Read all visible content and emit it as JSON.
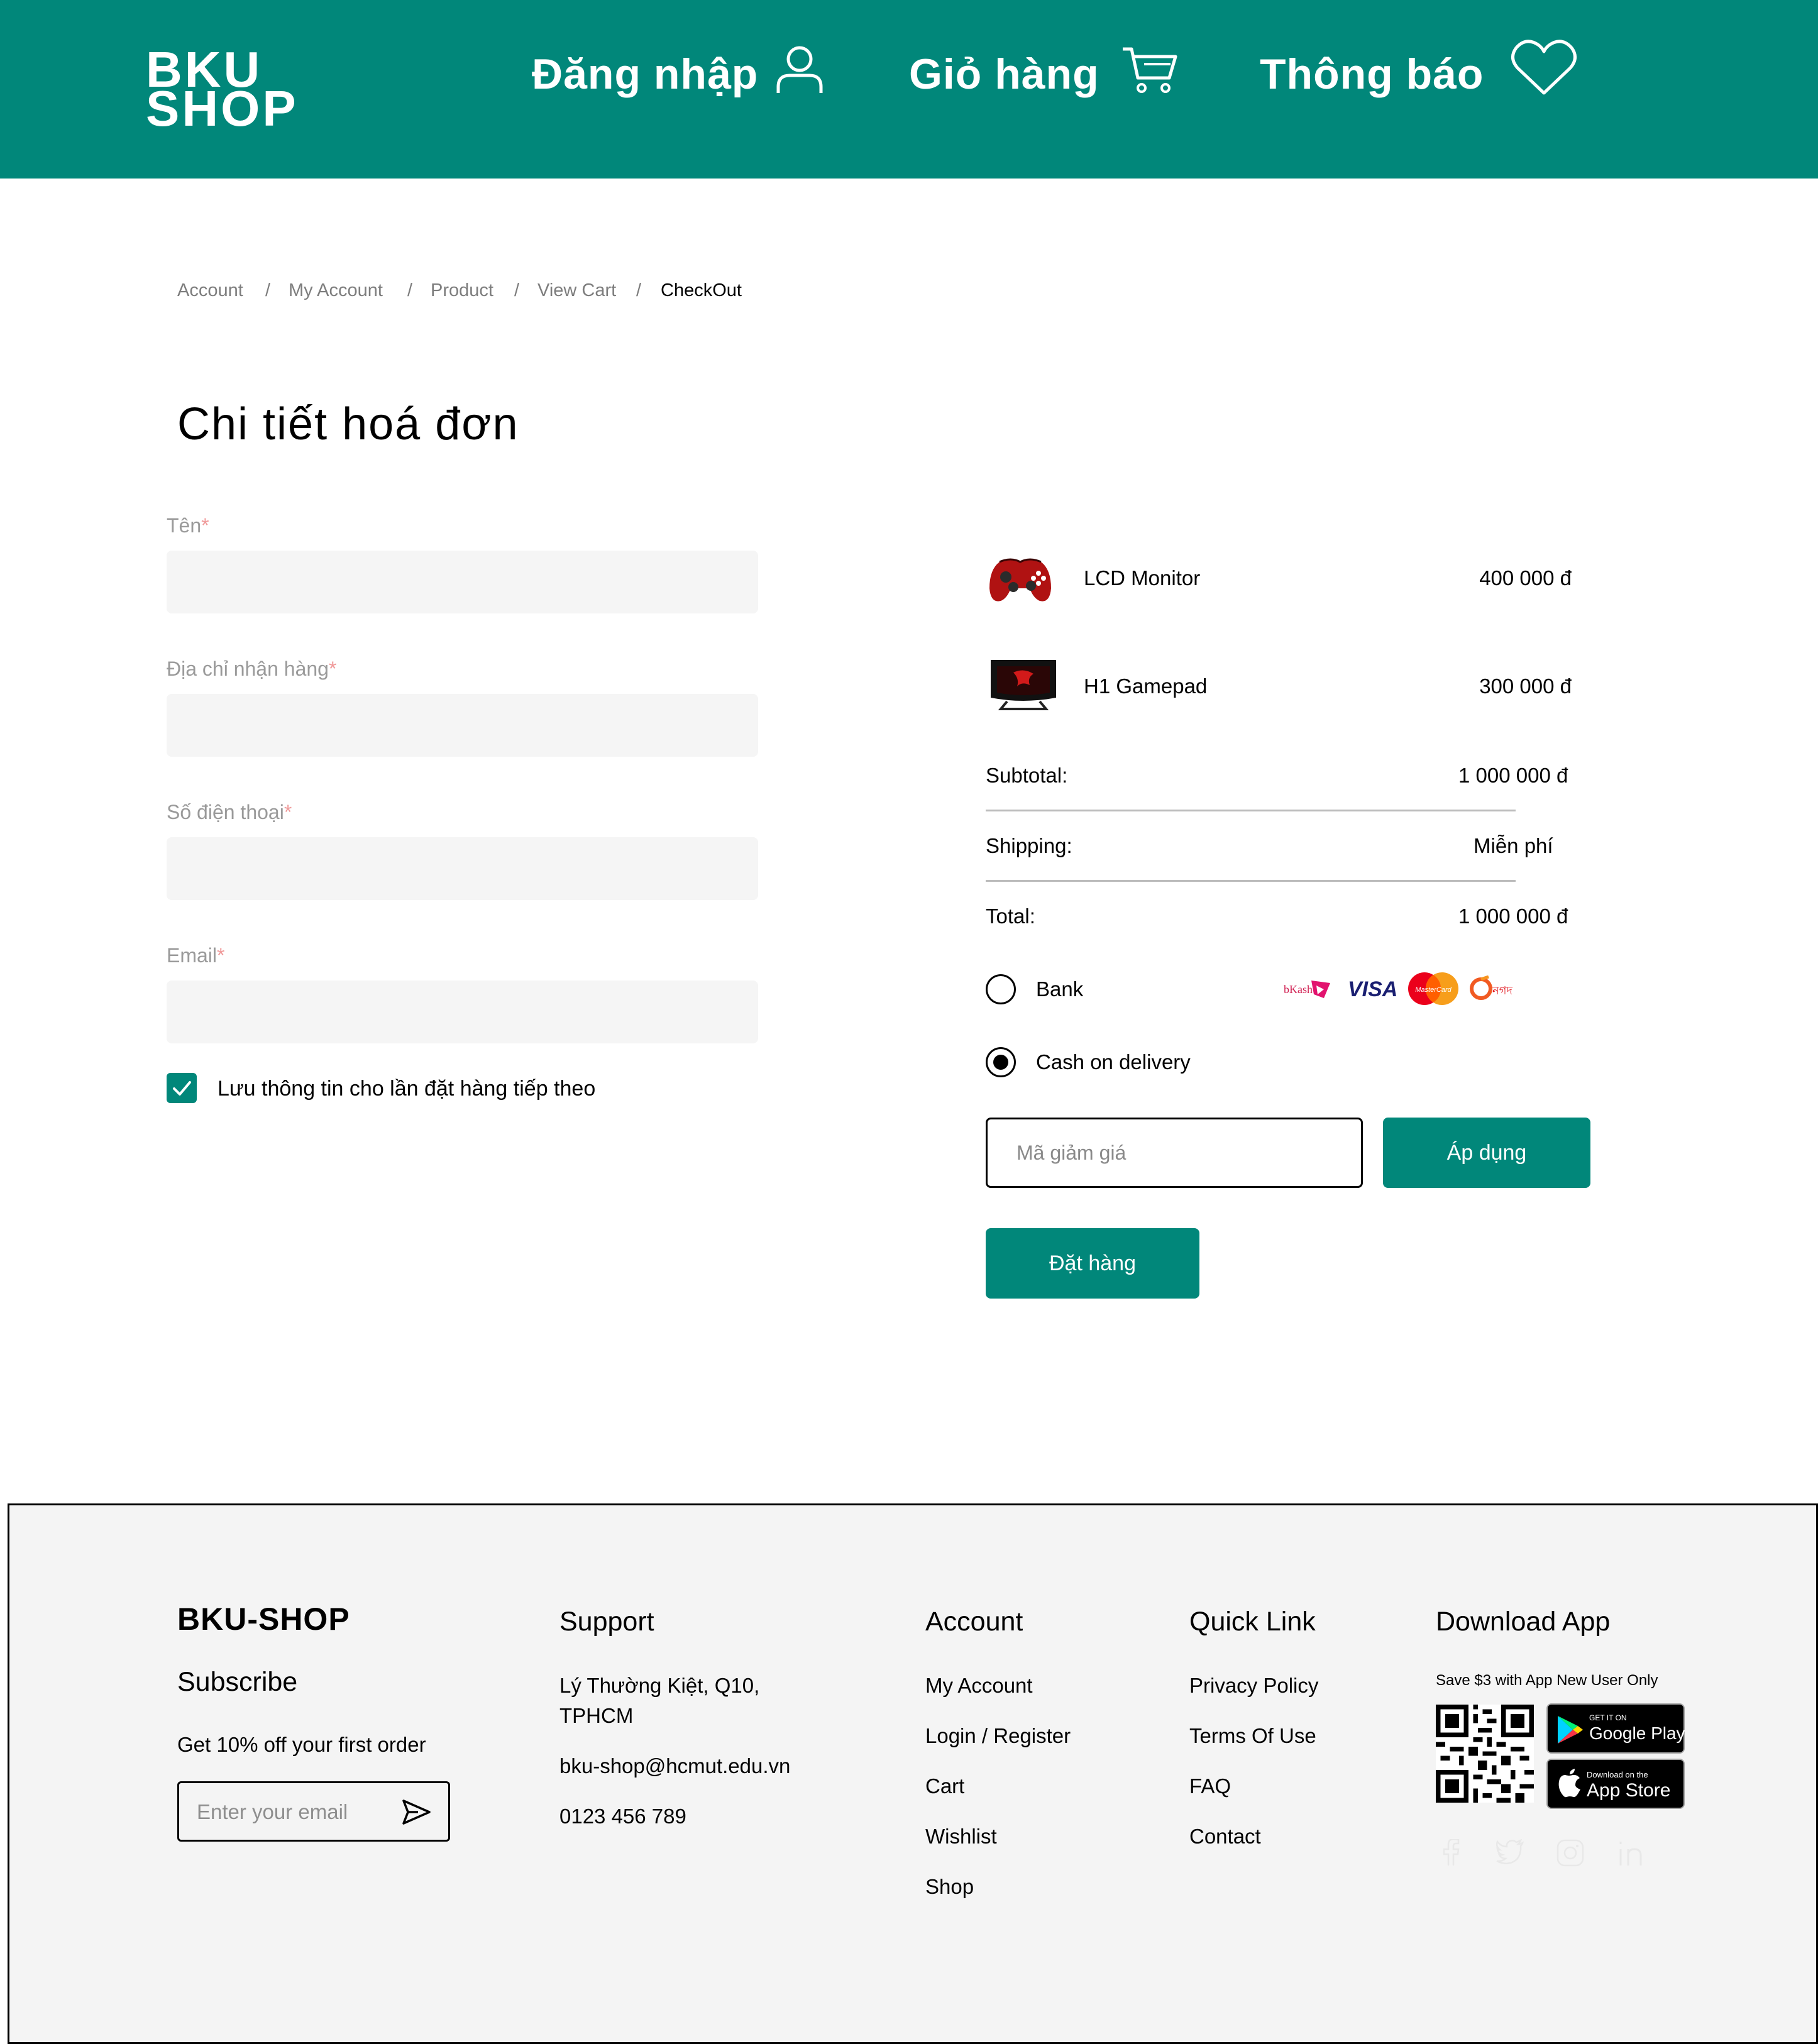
{
  "header": {
    "logo_line1": "BKU",
    "logo_line2": "SHOP",
    "nav": {
      "login": "Đăng nhập",
      "cart": "Giỏ hàng",
      "notifications": "Thông báo"
    }
  },
  "breadcrumb": [
    "Account",
    "My Account",
    "Product",
    "View Cart",
    "CheckOut"
  ],
  "breadcrumb_sep": "/",
  "page_title": "Chi tiết hoá đơn",
  "form": {
    "required_mark": "*",
    "fields": [
      {
        "label": "Tên",
        "value": ""
      },
      {
        "label": "Địa chỉ nhận hàng",
        "value": ""
      },
      {
        "label": "Số điện thoại",
        "value": ""
      },
      {
        "label": "Email",
        "value": ""
      }
    ],
    "save_info": {
      "label": "Lưu thông tin cho lần đặt hàng tiếp theo",
      "checked": true
    }
  },
  "order": {
    "items": [
      {
        "name": "LCD Monitor",
        "price": "400 000 đ",
        "icon": "gamepad-image"
      },
      {
        "name": "H1 Gamepad",
        "price": "300 000 đ",
        "icon": "monitor-image"
      }
    ],
    "subtotal_label": "Subtotal:",
    "subtotal_value": "1 000 000 đ",
    "shipping_label": "Shipping:",
    "shipping_value": "Miễn phí",
    "total_label": "Total:",
    "total_value": "1 000 000 đ",
    "payment": [
      {
        "label": "Bank",
        "selected": false
      },
      {
        "label": "Cash on delivery",
        "selected": true
      }
    ],
    "payment_logos": [
      "bKash",
      "VISA",
      "MasterCard",
      "নগদ"
    ],
    "coupon_placeholder": "Mã giảm giá",
    "apply_label": "Áp dụng",
    "place_order_label": "Đặt hàng"
  },
  "footer": {
    "brand": "BKU-SHOP",
    "subscribe_title": "Subscribe",
    "subscribe_text": "Get 10% off your first order",
    "email_placeholder": "Enter your email",
    "support": {
      "title": "Support",
      "address_line1": "Lý Thường Kiệt, Q10,",
      "address_line2": "TPHCM",
      "email": "bku-shop@hcmut.edu.vn",
      "phone": "0123 456 789"
    },
    "account": {
      "title": "Account",
      "links": [
        "My Account",
        "Login / Register",
        "Cart",
        "Wishlist",
        "Shop"
      ]
    },
    "quick_link": {
      "title": "Quick Link",
      "links": [
        "Privacy Policy",
        "Terms Of Use",
        "FAQ",
        "Contact"
      ]
    },
    "download": {
      "title": "Download App",
      "promo": "Save $3 with App New User Only",
      "google_small": "GET IT ON",
      "google_big": "Google Play",
      "apple_small": "Download on the",
      "apple_big": "App Store"
    },
    "socials": [
      "facebook-icon",
      "twitter-icon",
      "instagram-icon",
      "linkedin-icon"
    ]
  },
  "colors": {
    "brand": "#01877a",
    "input_bg": "#f5f5f5",
    "footer_bg": "#f4f4f4"
  }
}
